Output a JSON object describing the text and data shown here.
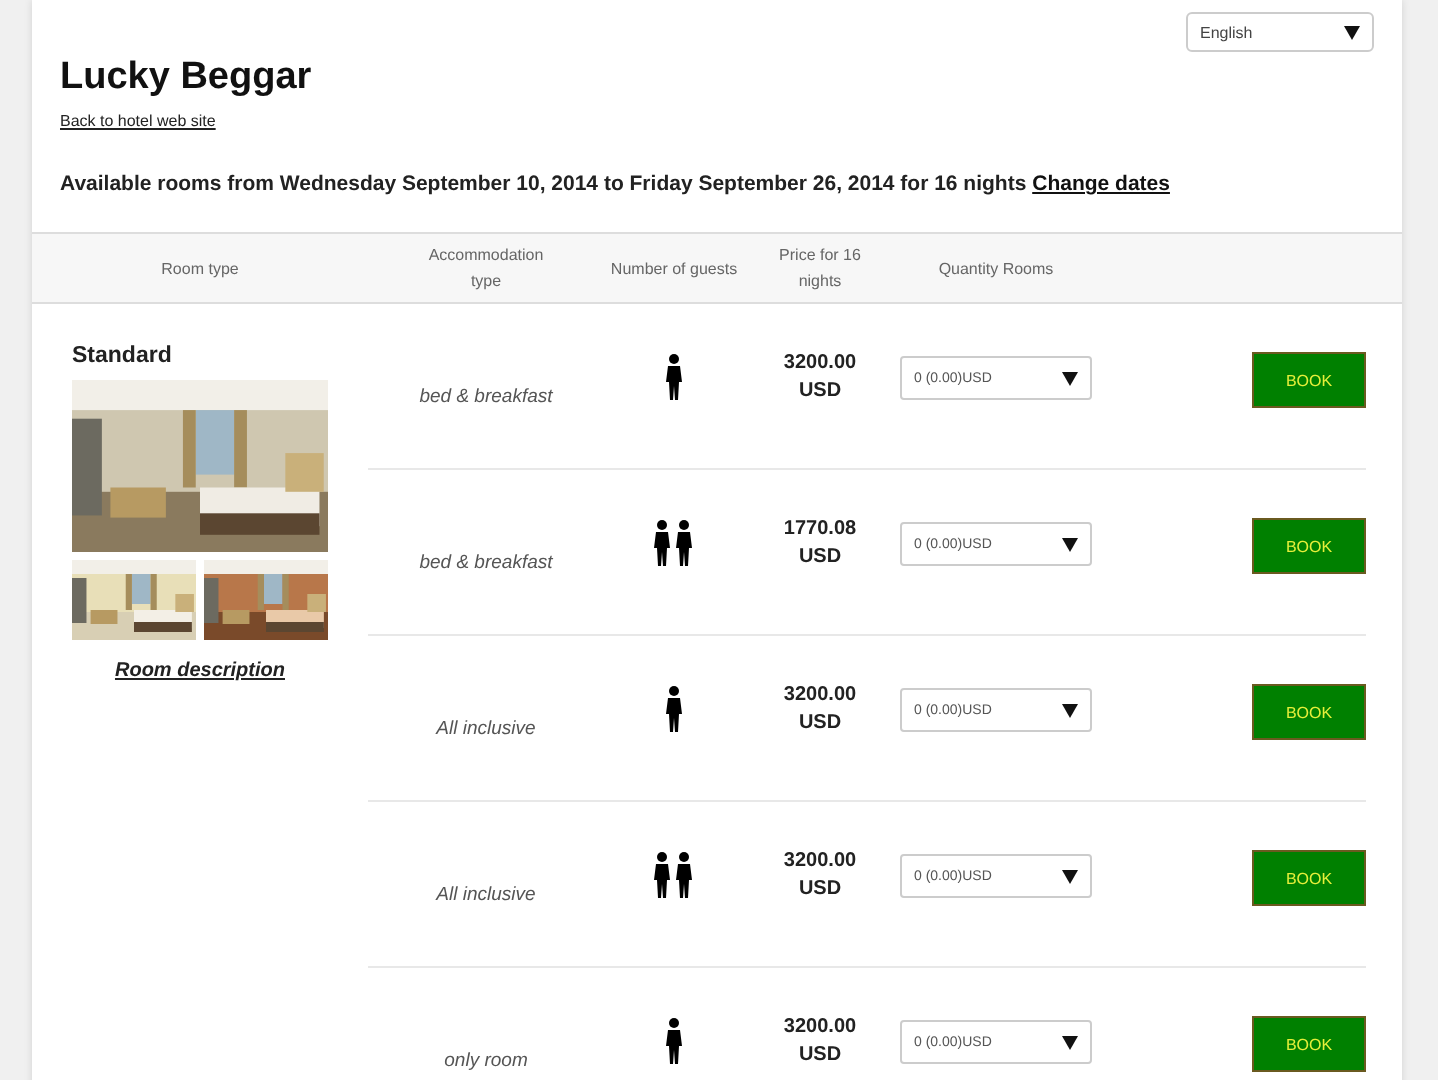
{
  "language_select": {
    "value": "English"
  },
  "hotel": {
    "name": "Lucky Beggar",
    "back_link": "Back to hotel web site"
  },
  "availability": {
    "text": "Available rooms from Wednesday September 10, 2014 to Friday September 26, 2014 for 16 nights",
    "link": "Change dates"
  },
  "table": {
    "columns": [
      {
        "label": "Room type"
      },
      {
        "label": "Accommodation type"
      },
      {
        "label": "Number of guests"
      },
      {
        "label": "Price for 16 nights"
      },
      {
        "label": "Quantity Rooms"
      }
    ],
    "room": {
      "name": "Standard",
      "description_link": "Room description"
    },
    "rows": [
      {
        "accommodation": "bed & breakfast",
        "kind": "single",
        "price": "3200.00",
        "currency": "USD",
        "quantity": "0 (0.00)USD",
        "button": "BOOK"
      },
      {
        "accommodation": "bed & breakfast",
        "kind": "double",
        "price": "1770.08",
        "currency": "USD",
        "quantity": "0 (0.00)USD",
        "button": "BOOK"
      },
      {
        "accommodation": "All inclusive",
        "kind": "single",
        "price": "3200.00",
        "currency": "USD",
        "quantity": "0 (0.00)USD",
        "button": "BOOK"
      },
      {
        "accommodation": "All inclusive",
        "kind": "double",
        "price": "3200.00",
        "currency": "USD",
        "quantity": "0 (0.00)USD",
        "button": "BOOK"
      },
      {
        "accommodation": "only room",
        "kind": "single",
        "price": "3200.00",
        "currency": "USD",
        "quantity": "0 (0.00)USD",
        "button": "BOOK"
      }
    ]
  }
}
